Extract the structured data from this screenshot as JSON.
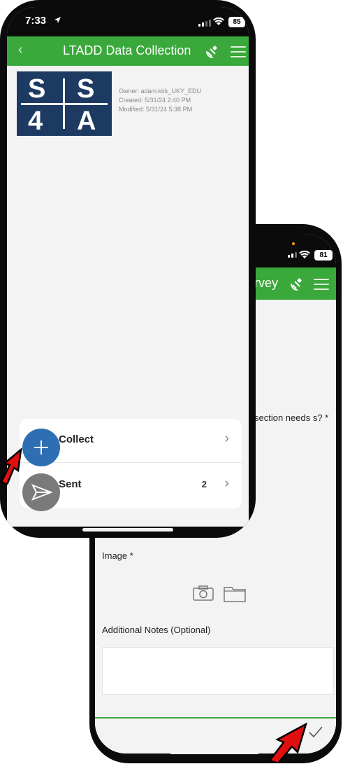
{
  "back_phone": {
    "title_fragment": "rvey",
    "battery": "81",
    "question_fragment": "section needs s? *",
    "image_label": "Image *",
    "notes_label": "Additional Notes (Optional)",
    "icons": [
      "satellite-icon",
      "menu-icon",
      "camera-icon",
      "folder-icon",
      "checkmark-icon"
    ]
  },
  "front_phone": {
    "time": "7:33",
    "battery": "85",
    "title": "LTADD Data Collection",
    "logo_letters": [
      "S",
      "S",
      "4",
      "A"
    ],
    "meta": {
      "owner": "Owner: adam.kirk_UKY_EDU",
      "created": "Created: 5/31/24 2:40 PM",
      "modified": "Modified: 5/31/24 5:38 PM"
    },
    "rows": [
      {
        "label": "Collect",
        "count": ""
      },
      {
        "label": "Sent",
        "count": "2"
      }
    ]
  },
  "colors": {
    "accent_green": "#3aa83b",
    "collect_blue": "#2e6fb3",
    "sent_gray": "#7a7a7a",
    "arrow_red": "#e01010",
    "logo_navy": "#1d3a63"
  }
}
